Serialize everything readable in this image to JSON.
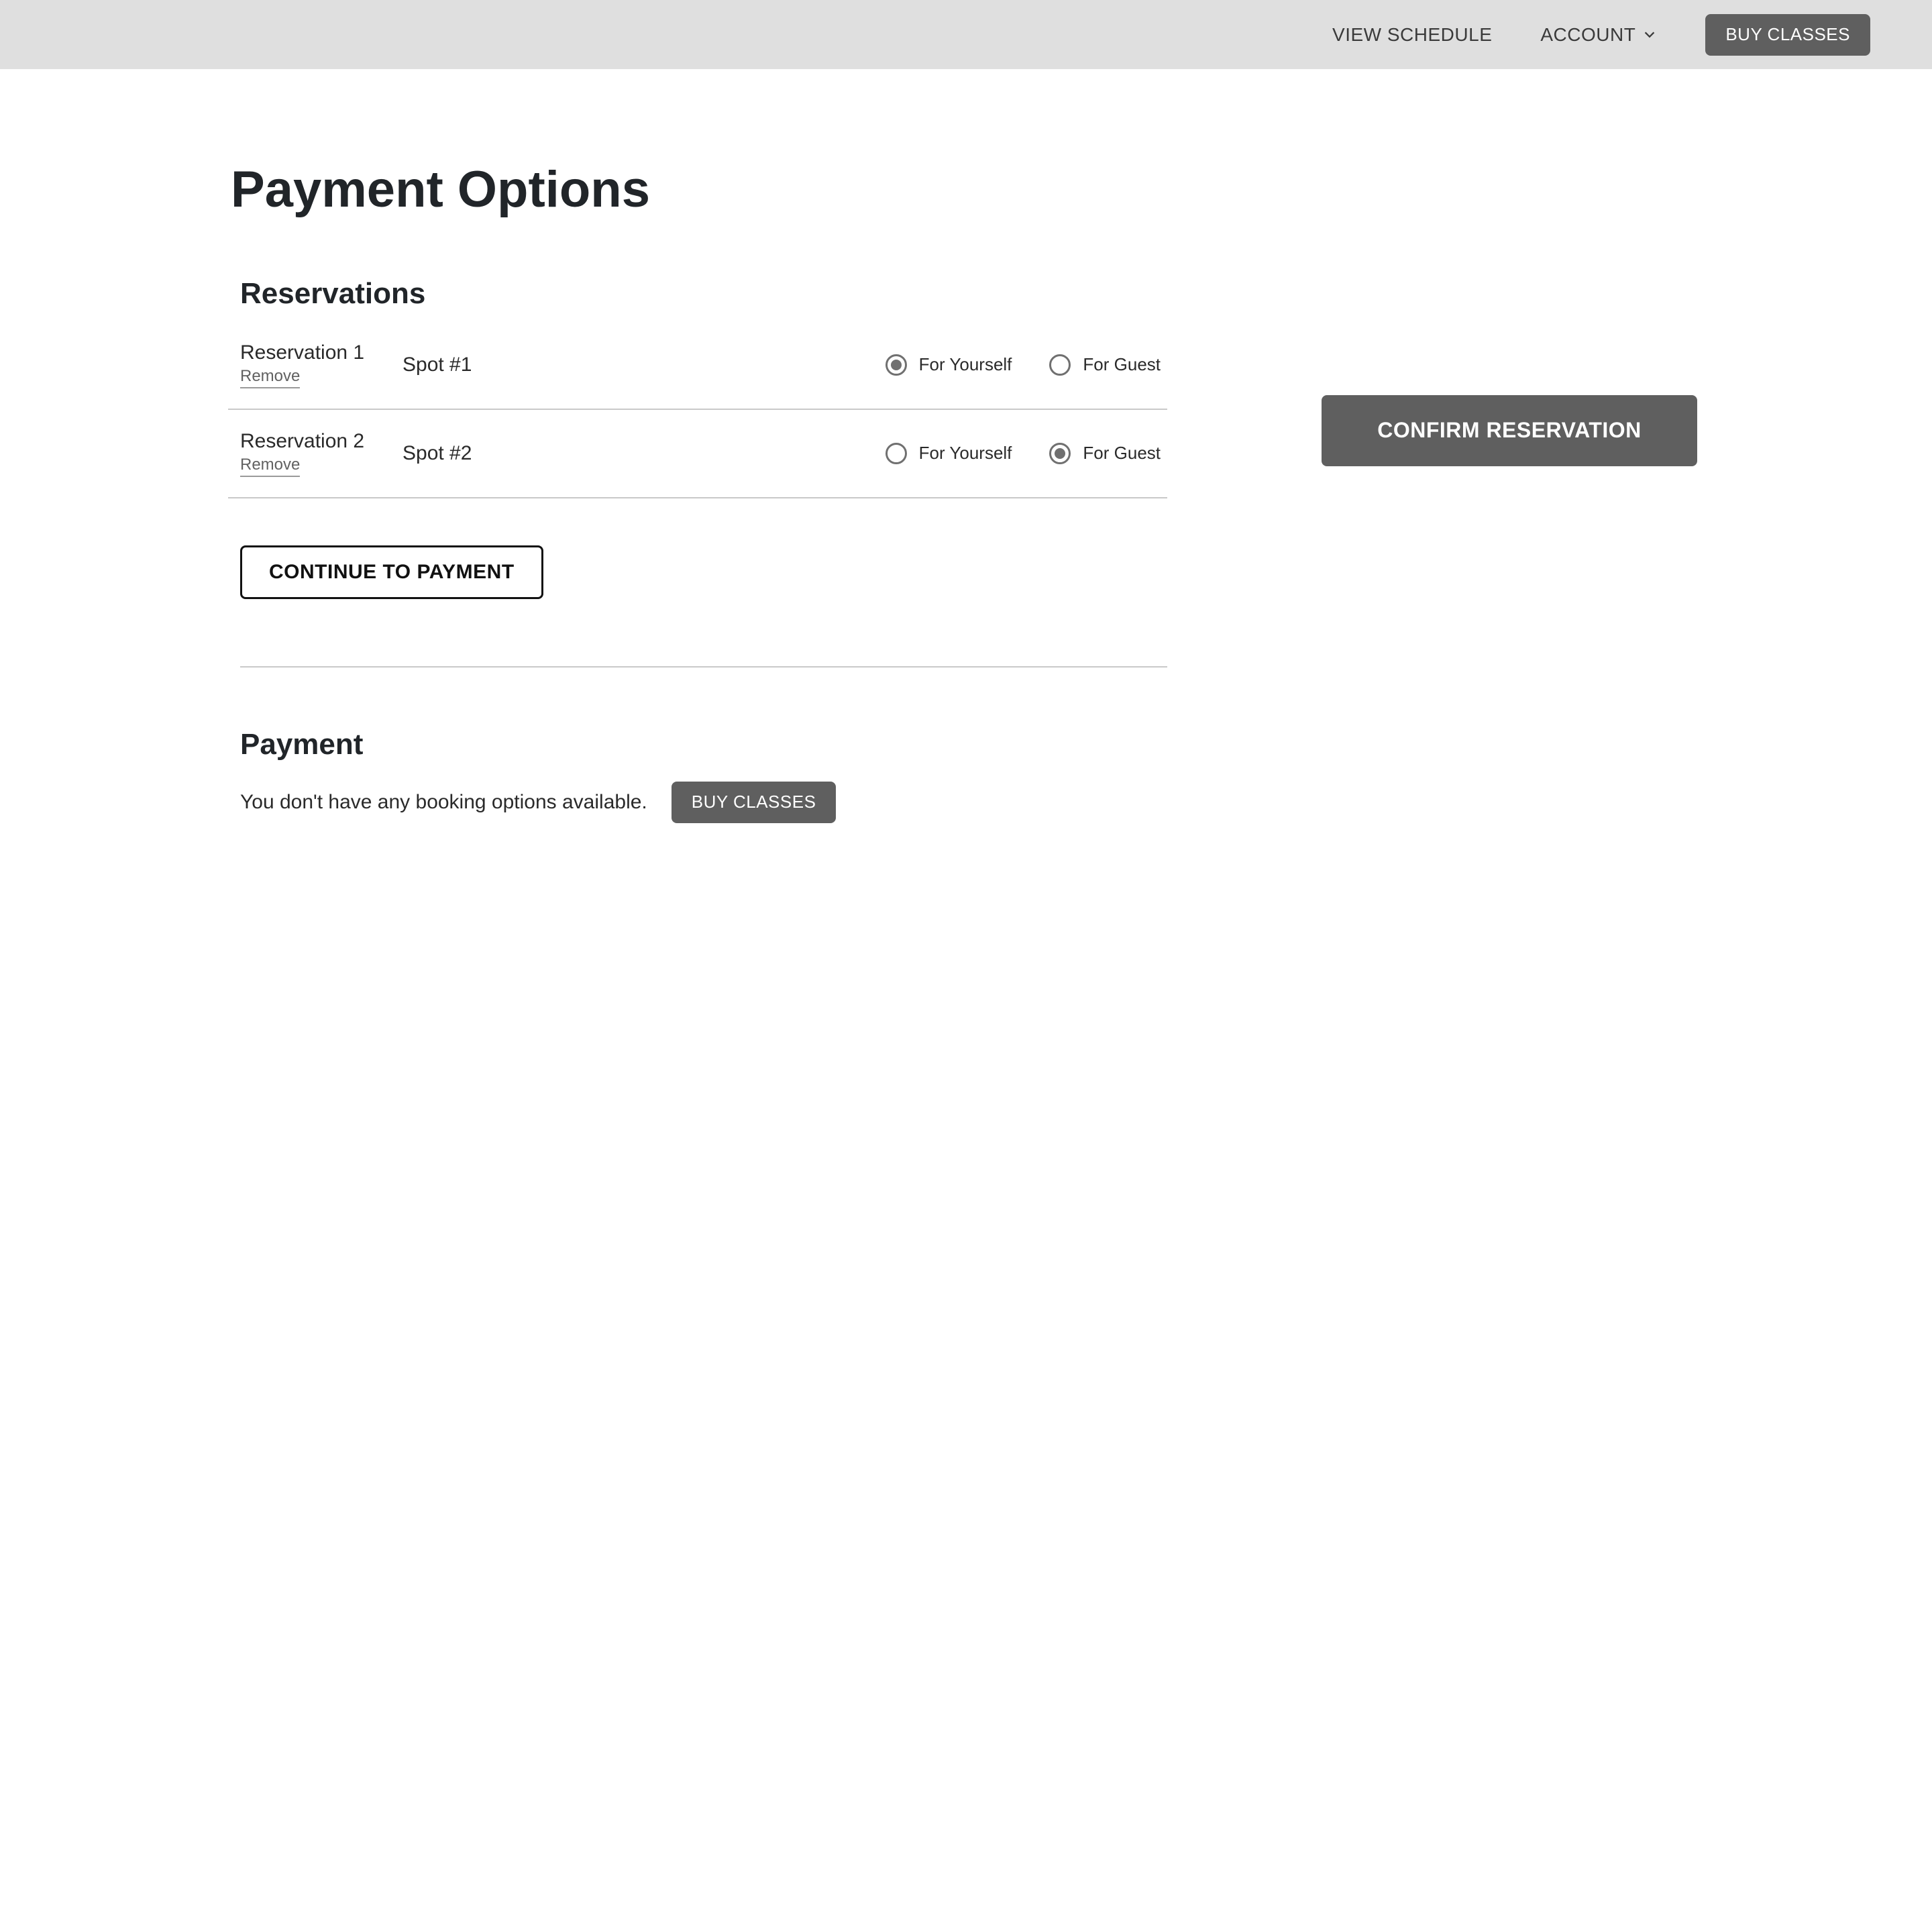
{
  "header": {
    "view_schedule": "VIEW SCHEDULE",
    "account": "ACCOUNT",
    "buy_classes": "BUY CLASSES"
  },
  "page_title": "Payment Options",
  "reservations": {
    "title": "Reservations",
    "remove_label": "Remove",
    "for_yourself": "For Yourself",
    "for_guest": "For Guest",
    "items": [
      {
        "name": "Reservation 1",
        "spot": "Spot #1",
        "selected": "yourself"
      },
      {
        "name": "Reservation 2",
        "spot": "Spot #2",
        "selected": "guest"
      }
    ],
    "continue": "CONTINUE TO PAYMENT"
  },
  "payment": {
    "title": "Payment",
    "empty_text": "You don't have any booking options available.",
    "buy_classes": "BUY CLASSES"
  },
  "side": {
    "confirm": "CONFIRM RESERVATION"
  }
}
